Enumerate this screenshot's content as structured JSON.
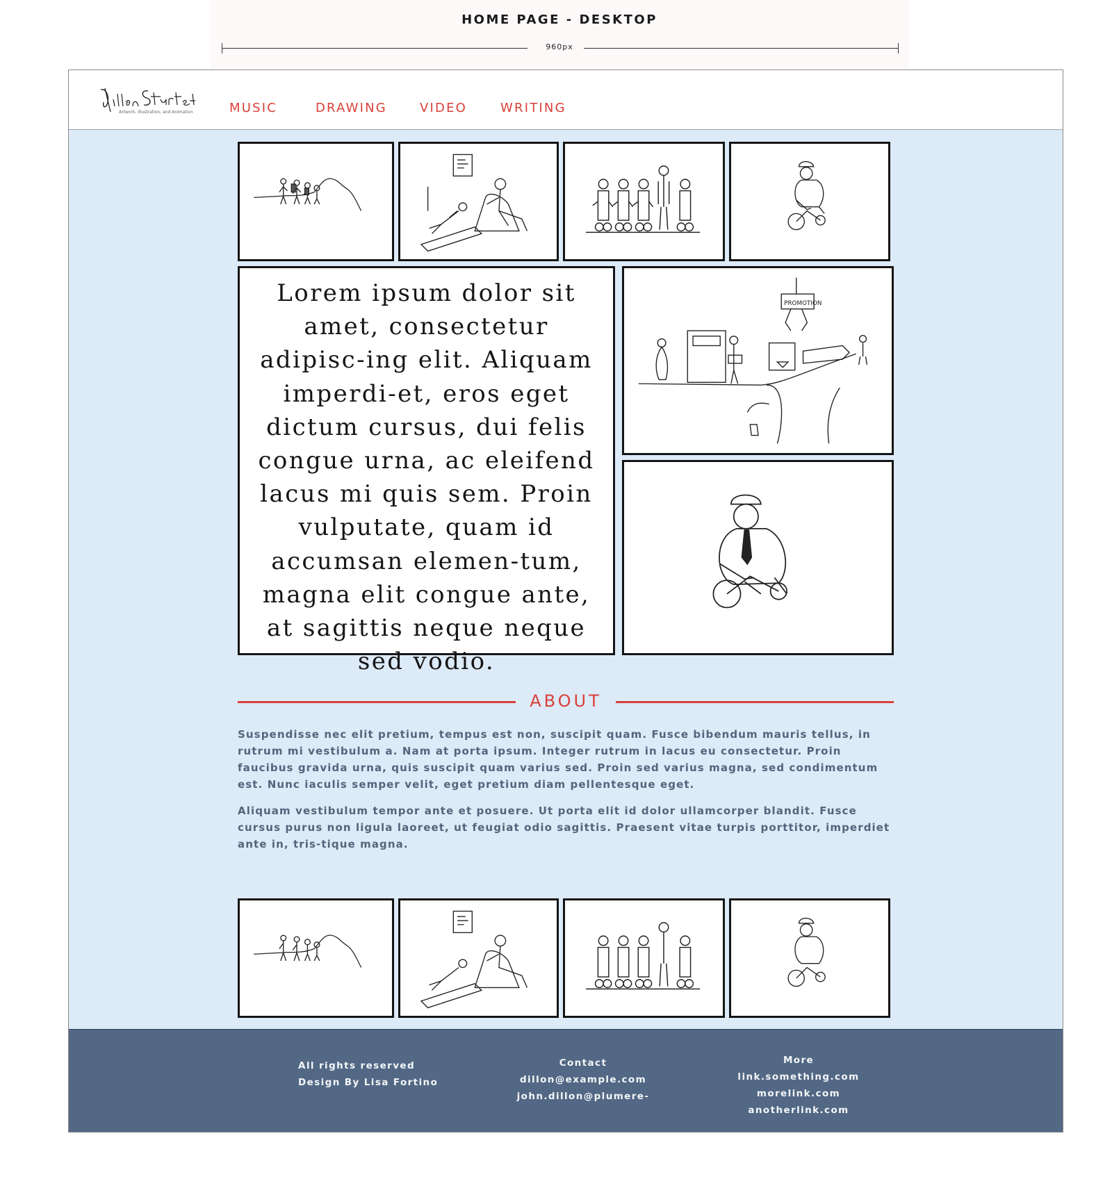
{
  "annotation": {
    "title": "HOME PAGE - DESKTOP",
    "width_label": "960px"
  },
  "header": {
    "logo_alt": "Dillon Sturtevant - Artwork, Illustration, and Animation",
    "nav": [
      {
        "label": "MUSIC"
      },
      {
        "label": "DRAWING"
      },
      {
        "label": "VIDEO"
      },
      {
        "label": "WRITING"
      }
    ]
  },
  "intro_text": "Lorem ipsum dolor sit amet, consectetur adipisc-ing elit. Aliquam imperdi-et, eros eget dictum cursus, dui felis congue urna, ac eleifend lacus mi quis sem. Proin vulputate, quam id accumsan elemen-tum, magna elit congue ante, at sagittis neque neque sed vodio.",
  "gallery_top": [
    {
      "icon": "hikers-mountain-drawing"
    },
    {
      "icon": "therapist-couch-drawing"
    },
    {
      "icon": "robots-lineup-drawing"
    },
    {
      "icon": "man-tricycle-drawing"
    }
  ],
  "featured": [
    {
      "icon": "promotion-claw-drawing"
    },
    {
      "icon": "man-tricycle-drawing"
    }
  ],
  "about": {
    "title": "ABOUT",
    "paragraphs": [
      "Suspendisse nec elit pretium, tempus est non, suscipit quam. Fusce bibendum mauris tellus, in rutrum mi vestibulum a. Nam at porta ipsum. Integer rutrum in lacus eu consectetur. Proin faucibus gravida urna, quis suscipit quam varius sed. Proin sed varius magna, sed condimentum est. Nunc iaculis semper velit, eget pretium diam pellentesque eget.",
      "Aliquam vestibulum tempor ante et posuere. Ut porta elit id dolor ullamcorper blandit. Fusce cursus purus non ligula laoreet, ut feugiat odio sagittis. Praesent vitae turpis porttitor, imperdiet ante in, tris-tique magna."
    ]
  },
  "gallery_bottom": [
    {
      "icon": "hikers-mountain-drawing"
    },
    {
      "icon": "therapist-couch-drawing"
    },
    {
      "icon": "robots-lineup-drawing"
    },
    {
      "icon": "man-tricycle-drawing"
    }
  ],
  "footer": {
    "rights": "All rights reserved",
    "credit": "Design By Lisa Fortino",
    "contact_heading": "Contact",
    "contact_email_1": "dillon@example.com",
    "contact_email_2": "john.dillon@plumere-",
    "more_heading": "More",
    "links": [
      "link.something.com",
      "morelink.com",
      "anotherlink.com"
    ]
  },
  "colors": {
    "accent": "#d9403a",
    "page_background": "#ddeaf7",
    "footer_background": "#526884",
    "body_text": "#53657c"
  }
}
